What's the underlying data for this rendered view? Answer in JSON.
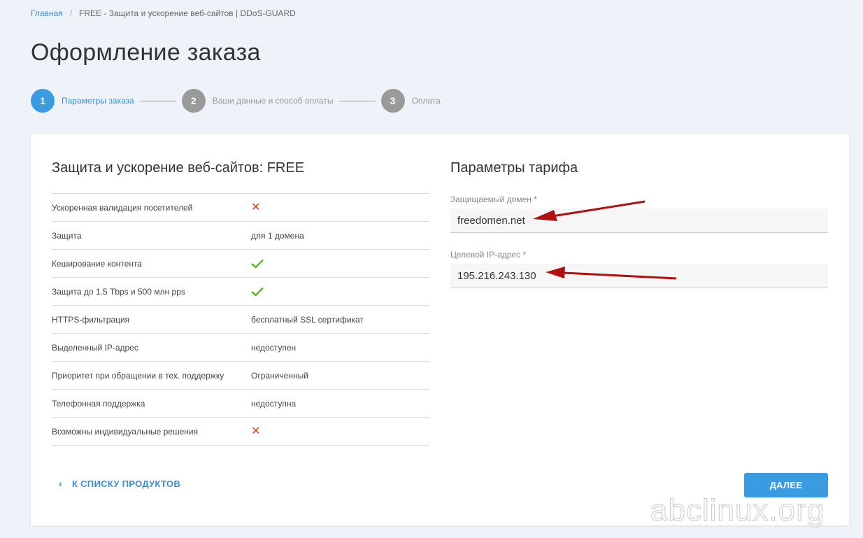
{
  "breadcrumb": {
    "home": "Главная",
    "separator": "/",
    "current": "FREE - Защита и ускорение веб-сайтов | DDoS-GUARD"
  },
  "page_title": "Оформление заказа",
  "steps": [
    {
      "number": "1",
      "label": "Параметры заказа",
      "active": true
    },
    {
      "number": "2",
      "label": "Ваши данные и способ оплаты",
      "active": false
    },
    {
      "number": "3",
      "label": "Оплата",
      "active": false
    }
  ],
  "product": {
    "title": "Защита и ускорение веб-сайтов: FREE",
    "features": [
      {
        "name": "Ускоренная валидация посетителей",
        "value": "",
        "icon": "cross-icon"
      },
      {
        "name": "Защита",
        "value": "для 1 домена",
        "icon": ""
      },
      {
        "name": "Кеширование контента",
        "value": "",
        "icon": "check-icon"
      },
      {
        "name": "Защита до 1.5 Tbps и 500 млн pps",
        "value": "",
        "icon": "check-icon"
      },
      {
        "name": "HTTPS-фильтрация",
        "value": "бесплатный SSL сертификат",
        "icon": ""
      },
      {
        "name": "Выделенный IP-адрес",
        "value": "недоступен",
        "icon": ""
      },
      {
        "name": "Приоритет при обращении в тех. поддержку",
        "value": "Ограниченный",
        "icon": ""
      },
      {
        "name": "Телефонная поддержка",
        "value": "недоступна",
        "icon": ""
      },
      {
        "name": "Возможны индивидуальные решения",
        "value": "",
        "icon": "cross-icon"
      }
    ]
  },
  "tariff": {
    "title": "Параметры тарифа",
    "domain_label": "Защищаемый домен *",
    "domain_value": "freedomen.net",
    "ip_label": "Целевой IP-адрес *",
    "ip_value": "195.216.243.130"
  },
  "actions": {
    "back_chevron": "‹",
    "back_label": "К СПИСКУ ПРОДУКТОВ",
    "next_label": "ДАЛЕЕ"
  },
  "watermark": "abclinux.org",
  "colors": {
    "accent": "#3a9be0",
    "cross": "#e0401c",
    "check": "#4caf1e",
    "arrow": "#b01010"
  }
}
